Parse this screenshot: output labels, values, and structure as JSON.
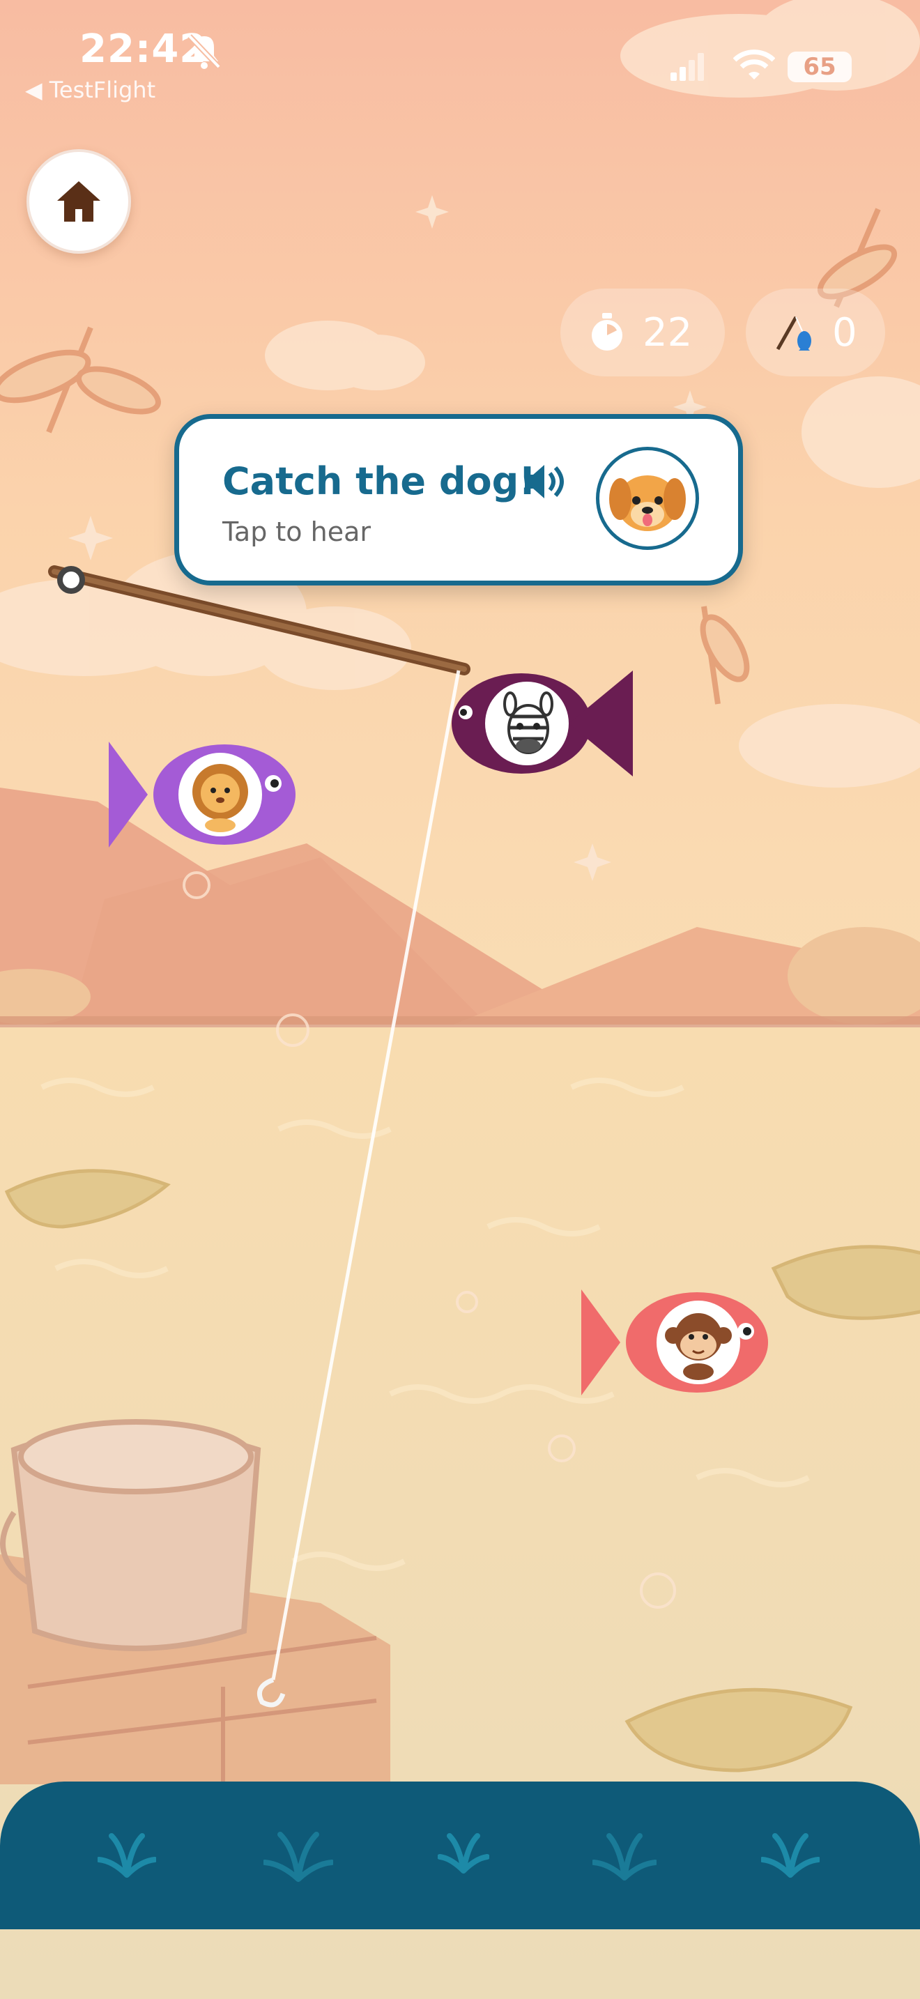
{
  "status_bar": {
    "time": "22:42",
    "back_app": "◀ TestFlight",
    "battery": "65",
    "icons": [
      "bell-slash-icon",
      "signal-icon",
      "wifi-icon",
      "battery-icon"
    ]
  },
  "hud": {
    "home_icon": "home-icon",
    "timer_icon": "stopwatch-icon",
    "timer_value": "22",
    "catch_icon": "fishing-rod-icon",
    "catch_value": "0"
  },
  "prompt": {
    "title": "Catch the dog!",
    "subtitle": "Tap to hear",
    "speaker_icon": "speaker-icon",
    "target_animal": "dog"
  },
  "fish": [
    {
      "animal": "zebra",
      "color": "#6a1d52",
      "facing": "left"
    },
    {
      "animal": "lion",
      "color": "#a45bd6",
      "facing": "right"
    },
    {
      "animal": "monkey",
      "color": "#f06b6b",
      "facing": "right"
    }
  ],
  "colors": {
    "accent": "#176a8e",
    "bottom_bar": "#0e5a78",
    "sky_top": "#f9c7a8",
    "water": "#f6e2b6"
  }
}
